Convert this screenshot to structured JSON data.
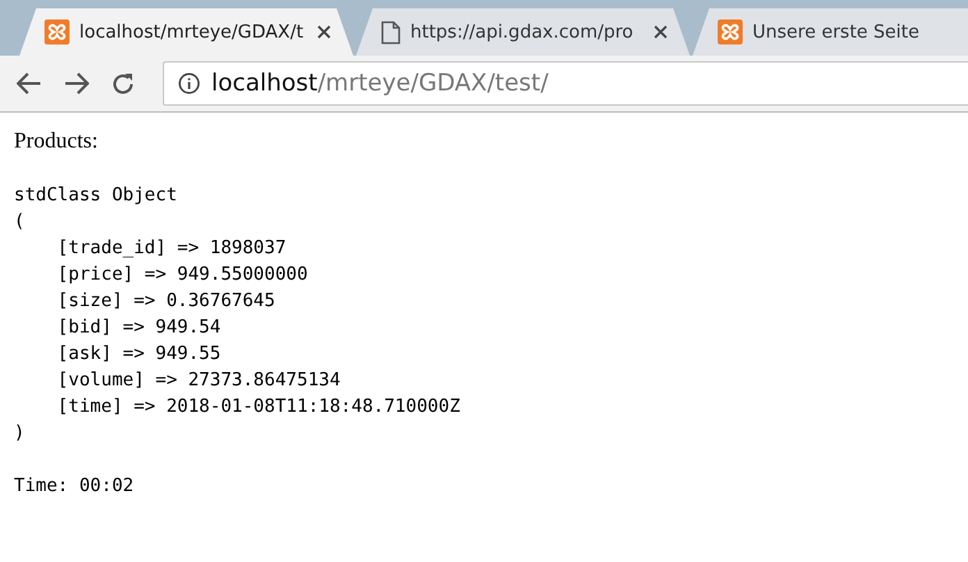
{
  "tabs": [
    {
      "title": "localhost/mrteye/GDAX/t",
      "kind": "site",
      "selected": true,
      "closable": true
    },
    {
      "title": "https://api.gdax.com/pro",
      "kind": "document",
      "selected": false,
      "closable": true
    },
    {
      "title": "Unsere erste Seite",
      "kind": "site",
      "selected": false,
      "closable": false
    }
  ],
  "address_bar": {
    "host": "localhost",
    "path": "/mrteye/GDAX/test/"
  },
  "page": {
    "heading": "Products:",
    "lines": [
      "stdClass Object",
      "(",
      "    [trade_id] => 1898037",
      "    [price] => 949.55000000",
      "    [size] => 0.36767645",
      "    [bid] => 949.54",
      "    [ask] => 949.55",
      "    [volume] => 27373.86475134",
      "    [time] => 2018-01-08T11:18:48.710000Z",
      ")"
    ],
    "footer": "Time: 00:02"
  }
}
